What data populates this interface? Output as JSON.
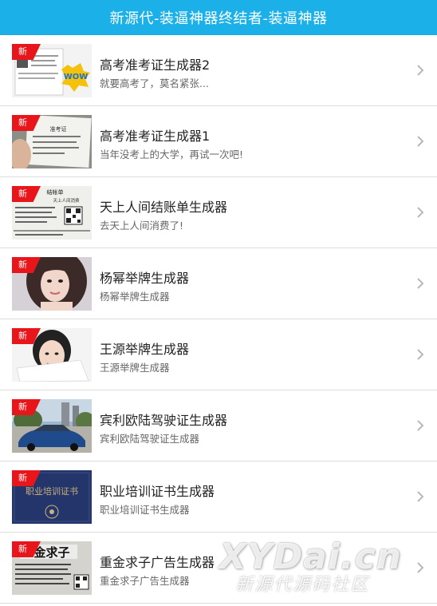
{
  "header": {
    "title": "新源代-装逼神器终结者-装逼神器"
  },
  "badge_label": "新",
  "items": [
    {
      "title": "高考准考证生成器2",
      "desc": "就要高考了，莫名紧张...",
      "thumb": "exam-ticket-wow"
    },
    {
      "title": "高考准考证生成器1",
      "desc": "当年没考上的大学，再试一次吧!",
      "thumb": "exam-ticket-hand"
    },
    {
      "title": "天上人间结账单生成器",
      "desc": "去天上人间消费了!",
      "thumb": "receipt-qr"
    },
    {
      "title": "杨幂举牌生成器",
      "desc": "杨幂举牌生成器",
      "thumb": "woman-portrait"
    },
    {
      "title": "王源举牌生成器",
      "desc": "王源举牌生成器",
      "thumb": "boy-holding-sign"
    },
    {
      "title": "宾利欧陆驾驶证生成器",
      "desc": "宾利欧陆驾驶证生成器",
      "thumb": "car-outdoors"
    },
    {
      "title": "职业培训证书生成器",
      "desc": "职业培训证书生成器",
      "thumb": "blue-certificate"
    },
    {
      "title": "重金求子广告生成器",
      "desc": "重金求子广告生成器",
      "thumb": "ad-poster"
    }
  ],
  "thumb_texts": {
    "receipt_heading": "结帐单",
    "receipt_sub": "天上人间消费",
    "certificate_text": "职业培训证书",
    "ad_text": "金求子",
    "exam_text": "准考证",
    "wow_text": "WOW"
  },
  "watermark": {
    "line1": "XYDai.cn",
    "line2": "新源代源码社区"
  },
  "colors": {
    "header": "#1bb1e8",
    "badge": "#e8161b",
    "chevron": "#b8b8b8"
  }
}
